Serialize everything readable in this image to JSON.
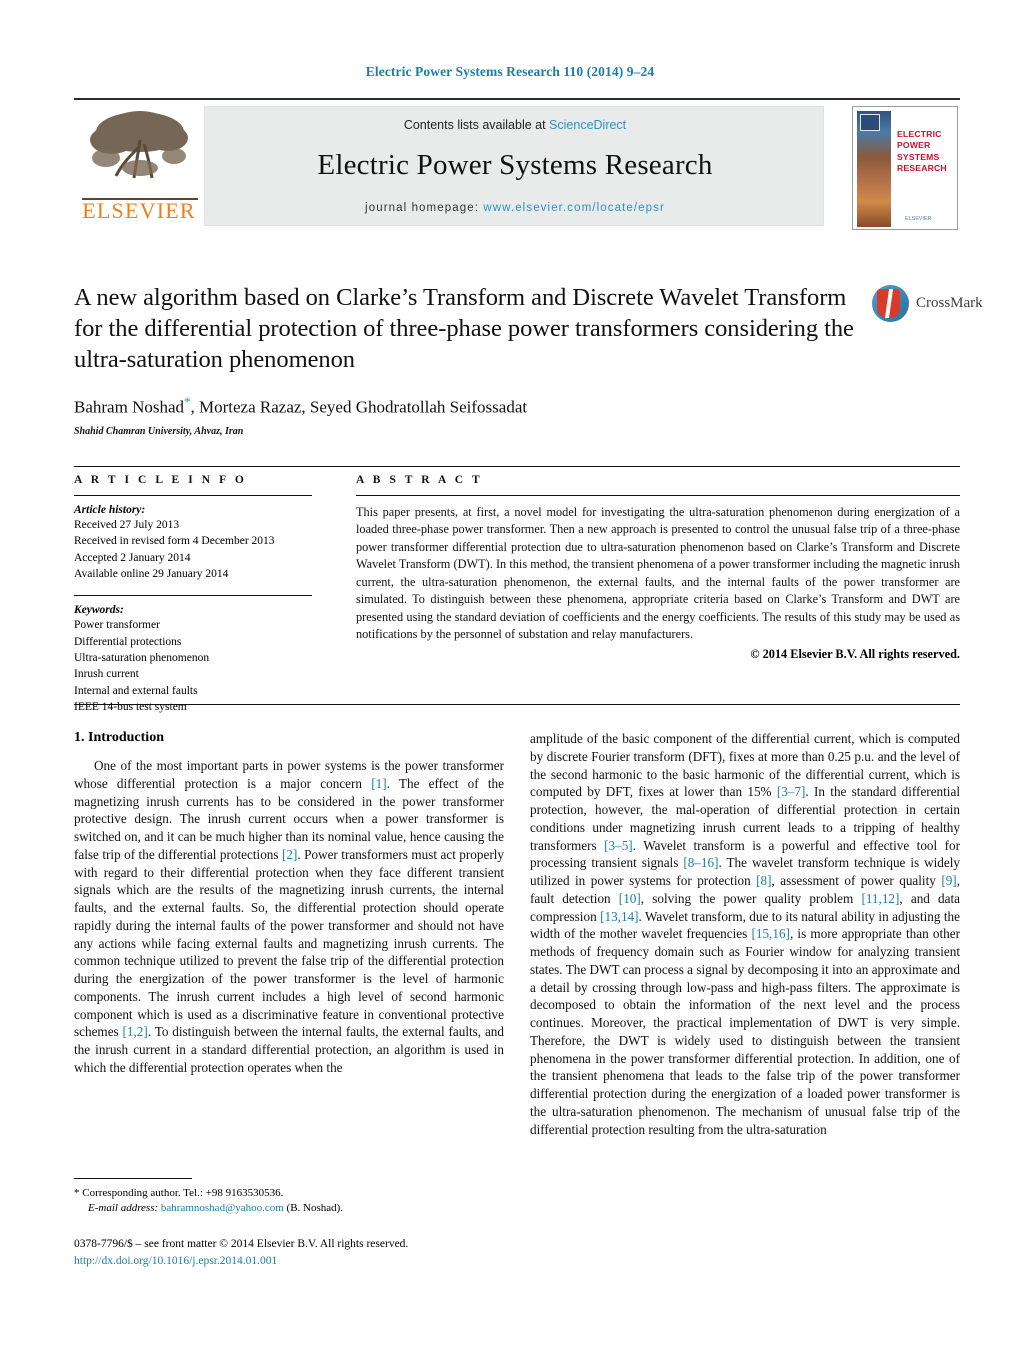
{
  "running_head": "Electric Power Systems Research 110 (2014) 9–24",
  "masthead": {
    "publisher_name": "ELSEVIER",
    "contents_prefix": "Contents lists available at ",
    "contents_link": "ScienceDirect",
    "journal_title": "Electric Power Systems Research",
    "homepage_prefix": "journal homepage: ",
    "homepage_url": "www.elsevier.com/locate/epsr",
    "cover_title": "ELECTRIC POWER SYSTEMS RESEARCH",
    "cover_footer": "ELSEVIER"
  },
  "article": {
    "title": "A new algorithm based on Clarke’s Transform and Discrete Wavelet Transform for the differential protection of three-phase power transformers considering the ultra-saturation phenomenon",
    "authors": "Bahram Noshad",
    "authors_rest": ", Morteza Razaz, Seyed Ghodratollah Seifossadat",
    "affiliation": "Shahid Chamran University, Ahvaz, Iran",
    "crossmark_label": "CrossMark"
  },
  "article_info": {
    "heading": "A R T I C L E   I N F O",
    "history_label": "Article history:",
    "history": [
      "Received 27 July 2013",
      "Received in revised form 4 December 2013",
      "Accepted 2 January 2014",
      "Available online 29 January 2014"
    ],
    "keywords_label": "Keywords:",
    "keywords": [
      "Power transformer",
      "Differential protections",
      "Ultra-saturation phenomenon",
      "Inrush current",
      "Internal and external faults",
      "IEEE 14-bus test system"
    ]
  },
  "abstract": {
    "heading": "A B S T R A C T",
    "text": "This paper presents, at first, a novel model for investigating the ultra-saturation phenomenon during energization of a loaded three-phase power transformer. Then a new approach is presented to control the unusual false trip of a three-phase power transformer differential protection due to ultra-saturation phenomenon based on Clarke’s Transform and Discrete Wavelet Transform (DWT). In this method, the transient phenomena of a power transformer including the magnetic inrush current, the ultra-saturation phenomenon, the external faults, and the internal faults of the power transformer are simulated. To distinguish between these phenomena, appropriate criteria based on Clarke’s Transform and DWT are presented using the standard deviation of coefficients and the energy coefficients. The results of this study may be used as notifications by the personnel of substation and relay manufacturers.",
    "copyright": "© 2014 Elsevier B.V. All rights reserved."
  },
  "introduction": {
    "section_title": "1.  Introduction",
    "left_p1_a": "One of the most important parts in power systems is the power transformer whose differential protection is a major concern ",
    "left_ref1": "[1]",
    "left_p1_b": ". The effect of the magnetizing inrush currents has to be considered in the power transformer protective design. The inrush current occurs when a power transformer is switched on, and it can be much higher than its nominal value, hence causing the false trip of the differential protections ",
    "left_ref2": "[2]",
    "left_p1_c": ". Power transformers must act properly with regard to their differential protection when they face different transient signals which are the results of the magnetizing inrush currents, the internal faults, and the external faults. So, the differential protection should operate rapidly during the internal faults of the power transformer and should not have any actions while facing external faults and magnetizing inrush currents. The common technique utilized to prevent the false trip of the differential protection during the energization of the power transformer is the level of harmonic components. The inrush current includes a high level of second harmonic component which is used as a discriminative feature in conventional protective schemes ",
    "left_ref3": "[1,2]",
    "left_p1_d": ". To distinguish between the internal faults, the external faults, and the inrush current in a standard differential protection, an algorithm is used in which the differential protection operates when the",
    "right_p_a": "amplitude of the basic component of the differential current, which is computed by discrete Fourier transform (DFT), fixes at more than 0.25 p.u. and the level of the second harmonic to the basic harmonic of the differential current, which is computed by DFT, fixes at lower than 15% ",
    "right_ref1": "[3–7]",
    "right_p_b": ". In the standard differential protection, however, the mal-operation of differential protection in certain conditions under magnetizing inrush current leads to a tripping of healthy transformers ",
    "right_ref2": "[3–5]",
    "right_p_c": ". Wavelet transform is a powerful and effective tool for processing transient signals ",
    "right_ref3": "[8–16]",
    "right_p_d": ". The wavelet transform technique is widely utilized in power systems for protection ",
    "right_ref4": "[8]",
    "right_p_e": ", assessment of power quality ",
    "right_ref5": "[9]",
    "right_p_f": ", fault detection ",
    "right_ref6": "[10]",
    "right_p_g": ", solving the power quality problem ",
    "right_ref7": "[11,12]",
    "right_p_h": ", and data compression ",
    "right_ref8": "[13,14]",
    "right_p_i": ". Wavelet transform, due to its natural ability in adjusting the width of the mother wavelet frequencies ",
    "right_ref9": "[15,16]",
    "right_p_j": ", is more appropriate than other methods of frequency domain such as Fourier window for analyzing transient states. The DWT can process a signal by decomposing it into an approximate and a detail by crossing through low-pass and high-pass filters. The approximate is decomposed to obtain the information of the next level and the process continues. Moreover, the practical implementation of DWT is very simple. Therefore, the DWT is widely used to distinguish between the transient phenomena in the power transformer differential protection. In addition, one of the transient phenomena that leads to the false trip of the power transformer differential protection during the energization of a loaded power transformer is the ultra-saturation phenomenon. The mechanism of unusual false trip of the differential protection resulting from the ultra-saturation"
  },
  "footnote": {
    "corresponding": "* Corresponding author. Tel.: +98 9163530536.",
    "email_label": "E-mail address: ",
    "email": "bahramnoshad@yahoo.com",
    "email_suffix": " (B. Noshad).",
    "imprint": "0378-7796/$ – see front matter © 2014 Elsevier B.V. All rights reserved.",
    "doi": "http://dx.doi.org/10.1016/j.epsr.2014.01.001"
  }
}
